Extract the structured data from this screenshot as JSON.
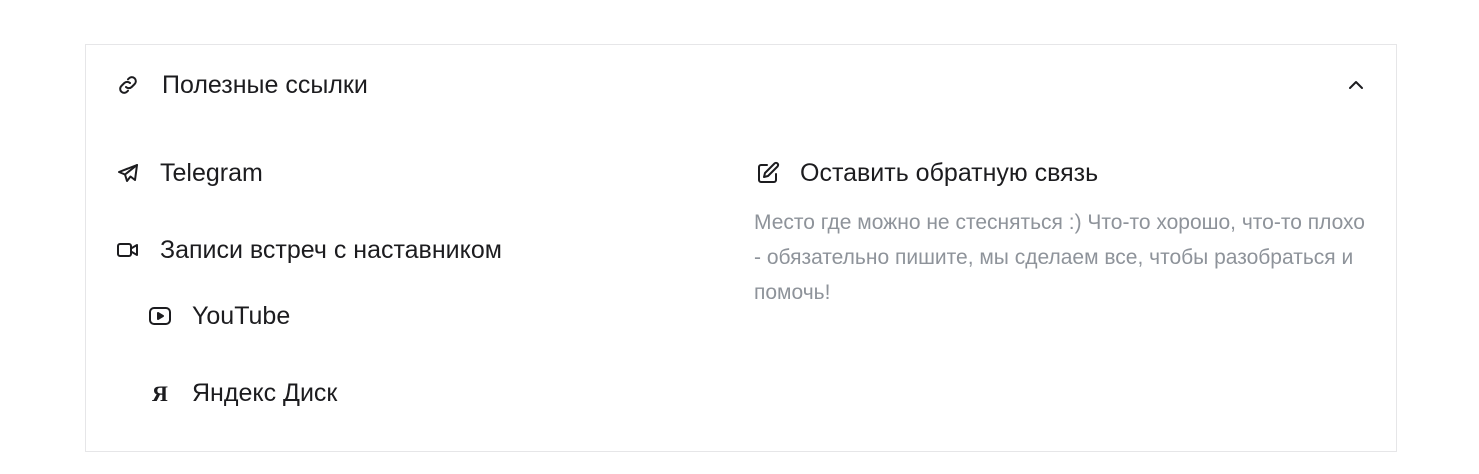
{
  "section": {
    "title": "Полезные ссылки",
    "icon": "link-icon",
    "toggle_icon": "chevron-up-icon",
    "expanded": true
  },
  "links": {
    "telegram": {
      "label": "Telegram",
      "icon": "telegram-icon"
    },
    "recordings": {
      "label": "Записи встреч с наставником",
      "icon": "video-camera-icon"
    },
    "youtube": {
      "label": "YouTube",
      "icon": "youtube-icon"
    },
    "yandex_disk": {
      "label": "Яндекс Диск",
      "icon": "yandex-icon",
      "glyph": "Я"
    }
  },
  "feedback": {
    "label": "Оставить обратную связь",
    "icon": "pencil-square-icon",
    "description": "Место где можно не стесняться :) Что-то хорошо, что-то плохо - обязательно пишите, мы сделаем все, чтобы разобраться и помочь!"
  },
  "colors": {
    "text": "#1c1c1f",
    "muted_text": "#8e939a",
    "border": "#e6e6e8",
    "background": "#ffffff"
  }
}
